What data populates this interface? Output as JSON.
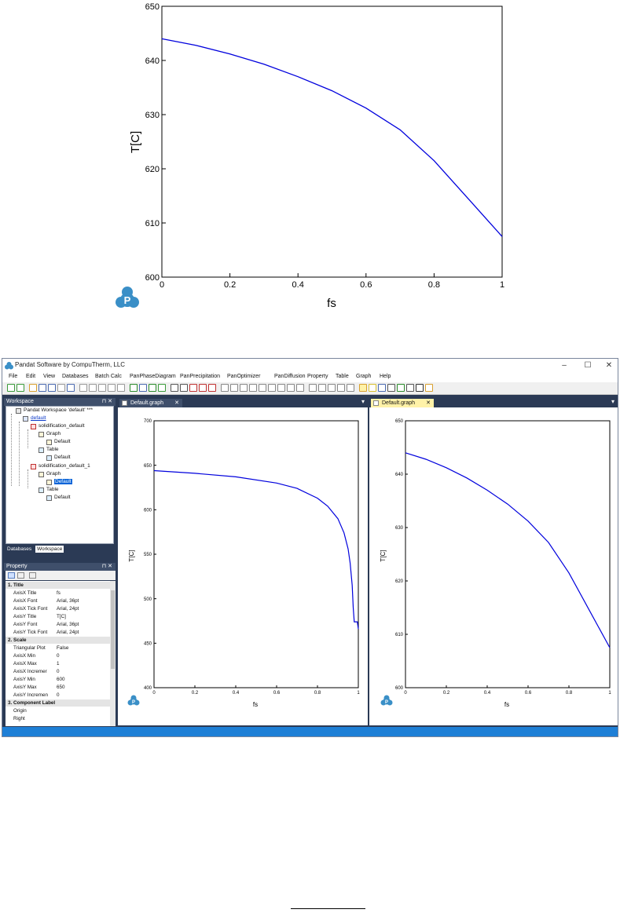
{
  "top_chart": {
    "xlabel": "fs",
    "ylabel": "T[C]",
    "xticks": [
      "0",
      "0.2",
      "0.4",
      "0.6",
      "0.8",
      "1"
    ],
    "yticks": [
      "600",
      "610",
      "620",
      "630",
      "640",
      "650"
    ]
  },
  "window": {
    "title": "Pandat Software by CompuTherm, LLC",
    "controls": {
      "minimize": "–",
      "maximize": "☐",
      "close": "✕"
    }
  },
  "menu": [
    "File",
    "Edit",
    "View",
    "Databases",
    "Batch Calc",
    "PanPhaseDiagram",
    "PanPrecipitation",
    "PanOptimizer",
    "PanDiffusion",
    "Property",
    "Table",
    "Graph",
    "Help"
  ],
  "workspace_panel": {
    "title": "Workspace",
    "pin": "⊓ ✕",
    "tree": {
      "root": "Pandat Workspace 'default' ***",
      "default": "default",
      "calc1": "solidification_default",
      "graph1": "Graph",
      "graph1_item": "Default",
      "table1": "Table",
      "table1_item": "Default",
      "calc2": "solidification_default_1",
      "graph2": "Graph",
      "graph2_item": "Default",
      "table2": "Table",
      "table2_item": "Default"
    },
    "tabs": [
      "Databases",
      "Workspace"
    ]
  },
  "property_panel": {
    "title": "Property",
    "pin": "⊓ ✕",
    "rows": [
      {
        "type": "cat",
        "k": "1. Title",
        "v": ""
      },
      {
        "type": "row",
        "k": "AxisX Title",
        "v": "fs"
      },
      {
        "type": "row",
        "k": "AxisX Font",
        "v": "Arial, 36pt"
      },
      {
        "type": "row",
        "k": "AxisX Tick Font",
        "v": "Arial, 24pt"
      },
      {
        "type": "row",
        "k": "AxisY Title",
        "v": "T[C]"
      },
      {
        "type": "row",
        "k": "AxisY Font",
        "v": "Arial, 36pt"
      },
      {
        "type": "row",
        "k": "AxisY Tick Font",
        "v": "Arial, 24pt"
      },
      {
        "type": "cat",
        "k": "2. Scale",
        "v": ""
      },
      {
        "type": "row",
        "k": "Triangular Plot",
        "v": "False"
      },
      {
        "type": "row",
        "k": "AxisX Min",
        "v": "0"
      },
      {
        "type": "row",
        "k": "AxisX Max",
        "v": "1"
      },
      {
        "type": "row",
        "k": "AxisX Incremer",
        "v": "0"
      },
      {
        "type": "row",
        "k": "AxisY Min",
        "v": "600"
      },
      {
        "type": "row",
        "k": "AxisY Max",
        "v": "650"
      },
      {
        "type": "row",
        "k": "AxisY Incremen",
        "v": "0"
      },
      {
        "type": "cat",
        "k": "3. Component Label",
        "v": ""
      },
      {
        "type": "row",
        "k": "Origin",
        "v": ""
      },
      {
        "type": "row",
        "k": "Right",
        "v": ""
      }
    ]
  },
  "doc_tabs": {
    "left": {
      "label": "Default.graph",
      "close": "✕"
    },
    "right": {
      "label": "Default.graph",
      "close": "✕"
    },
    "dropdown": "▾"
  },
  "left_chart": {
    "xlabel": "fs",
    "ylabel": "T[C]",
    "xticks": [
      "0",
      "0.2",
      "0.4",
      "0.6",
      "0.8",
      "1"
    ],
    "yticks": [
      "400",
      "450",
      "500",
      "550",
      "600",
      "650",
      "700"
    ]
  },
  "right_chart": {
    "xlabel": "fs",
    "ylabel": "T[C]",
    "xticks": [
      "0",
      "0.2",
      "0.4",
      "0.6",
      "0.8",
      "1"
    ],
    "yticks": [
      "600",
      "610",
      "620",
      "630",
      "640",
      "650"
    ]
  },
  "chart_data": [
    {
      "type": "line",
      "xlabel": "fs",
      "ylabel": "T[C]",
      "xlim": [
        0,
        1
      ],
      "ylim": [
        600,
        650
      ],
      "color": "#0000dd",
      "x": [
        0,
        0.1,
        0.2,
        0.3,
        0.4,
        0.5,
        0.6,
        0.7,
        0.8,
        0.9,
        0.95,
        1.0
      ],
      "y": [
        644,
        642.8,
        641.2,
        639.3,
        637,
        634.4,
        631.2,
        627.2,
        621.5,
        614.5,
        611,
        607.5
      ]
    },
    {
      "type": "line",
      "xlabel": "fs",
      "ylabel": "T[C]",
      "xlim": [
        0,
        1
      ],
      "ylim": [
        400,
        700
      ],
      "color": "#0000dd",
      "x": [
        0,
        0.2,
        0.4,
        0.6,
        0.7,
        0.8,
        0.85,
        0.9,
        0.93,
        0.95,
        0.96,
        0.97,
        0.975,
        0.98,
        0.985,
        0.99,
        0.995,
        1.0
      ],
      "y": [
        644,
        641,
        637,
        630,
        624,
        613,
        604,
        590,
        574,
        556,
        540,
        515,
        490,
        474,
        474,
        474,
        474,
        466
      ]
    },
    {
      "type": "line",
      "xlabel": "fs",
      "ylabel": "T[C]",
      "xlim": [
        0,
        1
      ],
      "ylim": [
        600,
        650
      ],
      "color": "#0000dd",
      "x": [
        0,
        0.1,
        0.2,
        0.3,
        0.4,
        0.5,
        0.6,
        0.7,
        0.8,
        0.9,
        0.95,
        1.0
      ],
      "y": [
        644,
        642.8,
        641.2,
        639.3,
        637,
        634.4,
        631.2,
        627.2,
        621.5,
        614.5,
        611,
        607.5
      ]
    }
  ]
}
